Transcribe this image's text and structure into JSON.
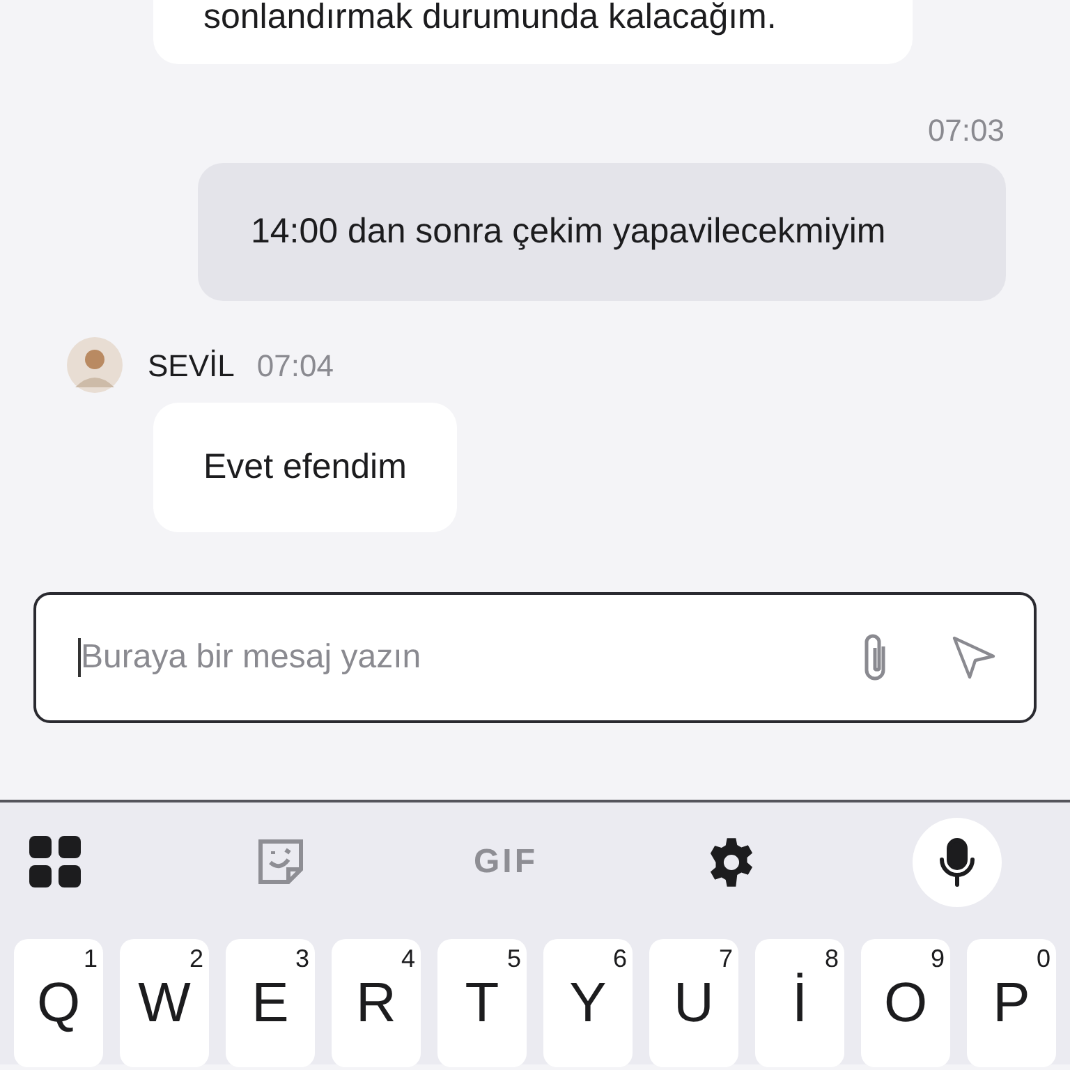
{
  "messages": [
    {
      "kind": "incoming",
      "text": "sonlandırmak durumunda kalacağım."
    },
    {
      "kind": "outgoing",
      "time": "07:03",
      "text": "14:00 dan sonra çekim yapavilecekmiyim"
    },
    {
      "kind": "incoming",
      "sender": "SEVİL",
      "time": "07:04",
      "text": "Evet efendim"
    }
  ],
  "composer": {
    "placeholder": "Buraya bir mesaj yazın"
  },
  "keyboard_toolbar": [
    {
      "kind": "grid"
    },
    {
      "kind": "sticker"
    },
    {
      "kind": "gif",
      "label": "GIF"
    },
    {
      "kind": "settings"
    },
    {
      "kind": "mic"
    }
  ],
  "keys": [
    {
      "letter": "Q",
      "number": "1"
    },
    {
      "letter": "W",
      "number": "2"
    },
    {
      "letter": "E",
      "number": "3"
    },
    {
      "letter": "R",
      "number": "4"
    },
    {
      "letter": "T",
      "number": "5"
    },
    {
      "letter": "Y",
      "number": "6"
    },
    {
      "letter": "U",
      "number": "7"
    },
    {
      "letter": "İ",
      "number": "8"
    },
    {
      "letter": "O",
      "number": "9"
    },
    {
      "letter": "P",
      "number": "0"
    }
  ]
}
